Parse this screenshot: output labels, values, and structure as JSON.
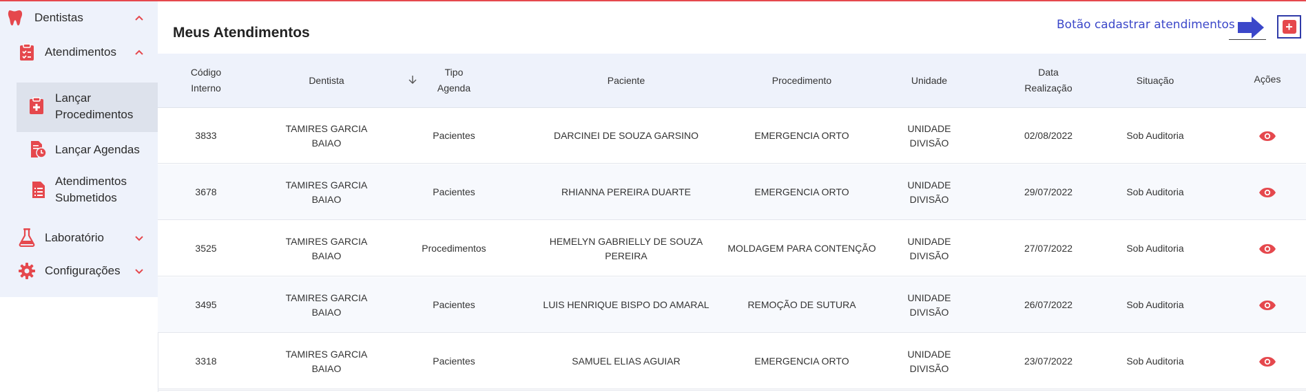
{
  "sidebar": {
    "items": [
      {
        "label": "Dentistas",
        "icon": "tooth-icon",
        "expanded": true
      },
      {
        "label": "Atendimentos",
        "icon": "clipboard-check-icon",
        "expanded": true
      },
      {
        "label": "Lançar\nProcedimentos",
        "icon": "clipboard-plus-icon",
        "active": true
      },
      {
        "label": "Lançar Agendas",
        "icon": "document-clock-icon"
      },
      {
        "label": "Atendimentos\nSubmetidos",
        "icon": "document-list-icon"
      },
      {
        "label": "Laboratório",
        "icon": "flask-icon",
        "expanded": false
      },
      {
        "label": "Configurações",
        "icon": "gear-icon",
        "expanded": false
      }
    ]
  },
  "main": {
    "title": "Meus Atendimentos",
    "annotation": "Botão cadastrar atendimentos",
    "add_button_label": "+"
  },
  "table": {
    "headers": {
      "codigo": "Código\nInterno",
      "dentista": "Dentista",
      "tipo": "Tipo\nAgenda",
      "paciente": "Paciente",
      "procedimento": "Procedimento",
      "unidade": "Unidade",
      "data": "Data\nRealização",
      "situacao": "Situação",
      "acoes": "Ações"
    },
    "rows": [
      {
        "codigo": "3833",
        "dentista": "TAMIRES GARCIA\nBAIAO",
        "tipo": "Pacientes",
        "paciente": "DARCINEI DE SOUZA GARSINO",
        "procedimento": "EMERGENCIA ORTO",
        "unidade": "UNIDADE\nDIVISÃO",
        "data": "02/08/2022",
        "situacao": "Sob Auditoria"
      },
      {
        "codigo": "3678",
        "dentista": "TAMIRES GARCIA\nBAIAO",
        "tipo": "Pacientes",
        "paciente": "RHIANNA PEREIRA DUARTE",
        "procedimento": "EMERGENCIA ORTO",
        "unidade": "UNIDADE\nDIVISÃO",
        "data": "29/07/2022",
        "situacao": "Sob Auditoria"
      },
      {
        "codigo": "3525",
        "dentista": "TAMIRES GARCIA\nBAIAO",
        "tipo": "Procedimentos",
        "paciente": "HEMELYN GABRIELLY DE SOUZA\nPEREIRA",
        "procedimento": "MOLDAGEM PARA CONTENÇÃO",
        "unidade": "UNIDADE\nDIVISÃO",
        "data": "27/07/2022",
        "situacao": "Sob Auditoria"
      },
      {
        "codigo": "3495",
        "dentista": "TAMIRES GARCIA\nBAIAO",
        "tipo": "Pacientes",
        "paciente": "LUIS HENRIQUE BISPO DO AMARAL",
        "procedimento": "REMOÇÃO DE SUTURA",
        "unidade": "UNIDADE\nDIVISÃO",
        "data": "26/07/2022",
        "situacao": "Sob Auditoria"
      },
      {
        "codigo": "3318",
        "dentista": "TAMIRES GARCIA\nBAIAO",
        "tipo": "Pacientes",
        "paciente": "SAMUEL ELIAS AGUIAR",
        "procedimento": "EMERGENCIA ORTO",
        "unidade": "UNIDADE\nDIVISÃO",
        "data": "23/07/2022",
        "situacao": "Sob Auditoria"
      }
    ]
  },
  "colors": {
    "accent": "#e5484d",
    "sidebar_bg": "#eef2fb",
    "annotation": "#3b47c9"
  }
}
